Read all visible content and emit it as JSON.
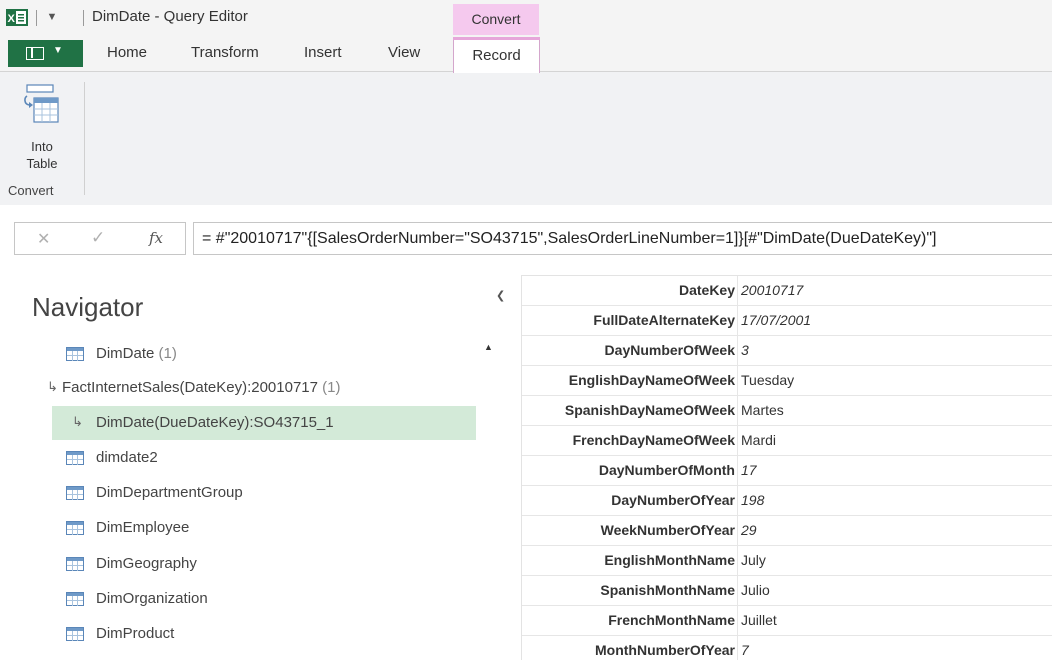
{
  "window": {
    "title": "DimDate - Query Editor",
    "contextual_group": "Convert"
  },
  "tabs": {
    "home": "Home",
    "transform": "Transform",
    "insert": "Insert",
    "view": "View",
    "record": "Record"
  },
  "ribbon": {
    "into_table_label": "Into\nTable",
    "group_label": "Convert"
  },
  "formula": {
    "text": "= #\"20010717\"{[SalesOrderNumber=\"SO43715\",SalesOrderLineNumber=1]}[#\"DimDate(DueDateKey)\"]"
  },
  "navigator": {
    "title": "Navigator",
    "items": [
      {
        "label": "DimDate",
        "count": "(1)",
        "icon": "table-icon"
      },
      {
        "label": "FactInternetSales(DateKey):20010717",
        "count": "(1)",
        "icon": "link-arrow-icon"
      },
      {
        "label": "DimDate(DueDateKey):SO43715_1",
        "count": "",
        "icon": "link-arrow-icon"
      },
      {
        "label": "dimdate2",
        "count": "",
        "icon": "table-icon"
      },
      {
        "label": "DimDepartmentGroup",
        "count": "",
        "icon": "table-icon"
      },
      {
        "label": "DimEmployee",
        "count": "",
        "icon": "table-icon"
      },
      {
        "label": "DimGeography",
        "count": "",
        "icon": "table-icon"
      },
      {
        "label": "DimOrganization",
        "count": "",
        "icon": "table-icon"
      },
      {
        "label": "DimProduct",
        "count": "",
        "icon": "table-icon"
      }
    ]
  },
  "record": {
    "rows": [
      {
        "field": "DateKey",
        "value": "20010717",
        "italic": true
      },
      {
        "field": "FullDateAlternateKey",
        "value": "17/07/2001",
        "italic": true
      },
      {
        "field": "DayNumberOfWeek",
        "value": "3",
        "italic": true
      },
      {
        "field": "EnglishDayNameOfWeek",
        "value": "Tuesday",
        "italic": false
      },
      {
        "field": "SpanishDayNameOfWeek",
        "value": "Martes",
        "italic": false
      },
      {
        "field": "FrenchDayNameOfWeek",
        "value": "Mardi",
        "italic": false
      },
      {
        "field": "DayNumberOfMonth",
        "value": "17",
        "italic": true
      },
      {
        "field": "DayNumberOfYear",
        "value": "198",
        "italic": true
      },
      {
        "field": "WeekNumberOfYear",
        "value": "29",
        "italic": true
      },
      {
        "field": "EnglishMonthName",
        "value": "July",
        "italic": false
      },
      {
        "field": "SpanishMonthName",
        "value": "Julio",
        "italic": false
      },
      {
        "field": "FrenchMonthName",
        "value": "Juillet",
        "italic": false
      },
      {
        "field": "MonthNumberOfYear",
        "value": "7",
        "italic": true
      }
    ]
  },
  "colors": {
    "excel_green": "#207245",
    "contextual_pink": "#f5c9ee",
    "selected_row": "#d3ead8"
  }
}
